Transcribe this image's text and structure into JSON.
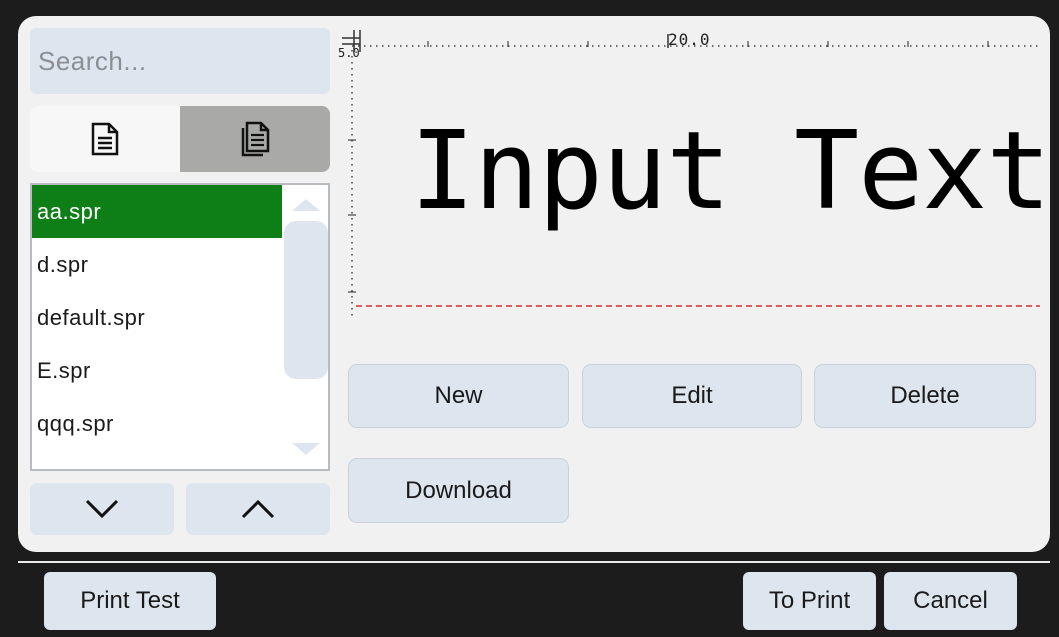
{
  "search": {
    "placeholder": "Search..."
  },
  "view_toggle": {
    "left_icon": "document-icon",
    "right_icon": "documents-icon"
  },
  "file_list": {
    "items": [
      {
        "label": "aa.spr",
        "selected": true
      },
      {
        "label": "d.spr",
        "selected": false
      },
      {
        "label": "default.spr",
        "selected": false
      },
      {
        "label": "E.spr",
        "selected": false
      },
      {
        "label": "qqq.spr",
        "selected": false
      }
    ]
  },
  "navigation": {
    "down_icon": "chevron-down-icon",
    "up_icon": "chevron-up-icon"
  },
  "preview": {
    "text": "Input Text",
    "ruler_label": "20.0",
    "vertical_ruler_label": "5.0"
  },
  "actions": {
    "new_label": "New",
    "edit_label": "Edit",
    "delete_label": "Delete",
    "download_label": "Download"
  },
  "footer": {
    "print_test_label": "Print Test",
    "to_print_label": "To Print",
    "cancel_label": "Cancel"
  },
  "colors": {
    "background": "#1c1c1c",
    "panel": "#f1f1f1",
    "button": "#dde6ee",
    "selected": "#0e7f16",
    "baseline": "#d32f2f"
  }
}
